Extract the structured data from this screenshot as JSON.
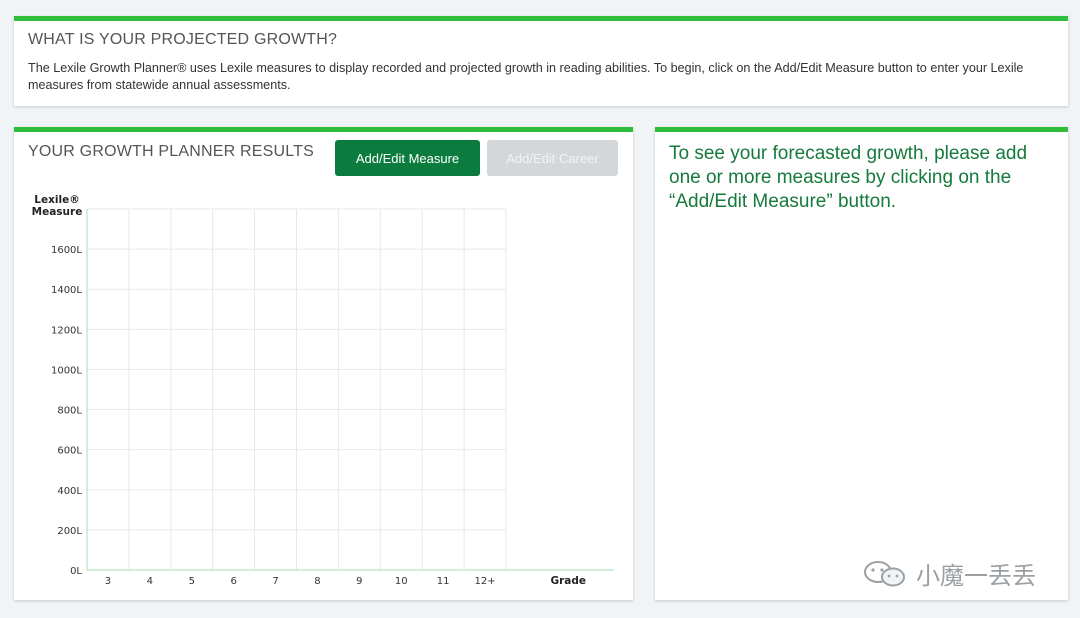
{
  "intro": {
    "title": "WHAT IS YOUR PROJECTED GROWTH?",
    "text": "The Lexile Growth Planner® uses Lexile measures to display recorded and projected growth in reading abilities. To begin, click on the Add/Edit Measure button to enter your Lexile measures from statewide annual assessments."
  },
  "results": {
    "title": "YOUR GROWTH PLANNER RESULTS",
    "add_measure_label": "Add/Edit Measure",
    "add_career_label": "Add/Edit Career"
  },
  "chart_data": {
    "type": "line",
    "ylabel": "Lexile® Measure",
    "ylabel_lines": [
      "Lexile®",
      "Measure"
    ],
    "xlabel": "Grade",
    "categories": [
      "3",
      "4",
      "5",
      "6",
      "7",
      "8",
      "9",
      "10",
      "11",
      "12+"
    ],
    "y_ticks": [
      "0L",
      "200L",
      "400L",
      "600L",
      "800L",
      "1000L",
      "1200L",
      "1400L",
      "1600L"
    ],
    "ylim": [
      0,
      1800
    ],
    "series": [],
    "grid": true
  },
  "forecast": {
    "message": "To see your forecasted growth, please add one or more measures by clicking on the “Add/Edit Measure” button."
  },
  "watermark": {
    "text": "小魔一丢丢",
    "icon": "wechat-icon"
  },
  "colors": {
    "accent_green": "#2fbe3c",
    "button_green": "#0b7c3e",
    "button_disabled": "#d4d7d9",
    "message_green": "#157a3c"
  }
}
